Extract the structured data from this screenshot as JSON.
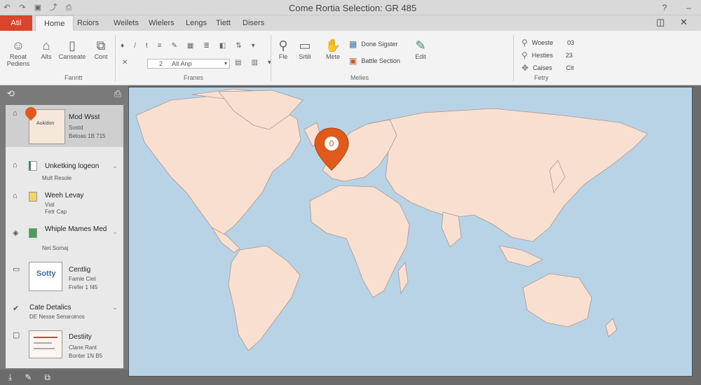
{
  "window": {
    "title": "Come Rortia Selection: GR 485",
    "qat_icons": [
      "undo-icon",
      "redo-icon",
      "save-icon",
      "share-icon",
      "print-icon"
    ],
    "right_controls": [
      "help-icon",
      "close-icon"
    ]
  },
  "tabs": {
    "file": "Atil",
    "items": [
      "Home",
      "Rciors",
      "Weilets",
      "Wielers",
      "Lengs",
      "Tiett",
      "Disers"
    ],
    "active": "Home"
  },
  "ribbon": {
    "first": [
      {
        "label": "Reoat Pediens",
        "icon": "person-icon"
      },
      {
        "label": "Alts",
        "icon": "building-icon"
      },
      {
        "label": "Canseate",
        "icon": "document-icon"
      },
      {
        "label": "Cont",
        "icon": "copy-icon"
      }
    ],
    "first_group": "Fanntt",
    "format_group": "Franes",
    "format_input": "Alt Anp",
    "format_input_prefix": "2",
    "media": [
      {
        "label": "Fle",
        "icon": "link-icon"
      },
      {
        "label": "Srtili",
        "icon": "slide-icon"
      },
      {
        "label": "Mete",
        "icon": "hand-icon"
      }
    ],
    "media_list": [
      "Done Sigster",
      "Battle Section"
    ],
    "media_edit": "Edit",
    "media_group": "Melies",
    "right_list": [
      {
        "label": "Woeste",
        "value": "03",
        "icon": "pin-icon"
      },
      {
        "label": "Hesties",
        "value": "23",
        "icon": "pin-icon"
      },
      {
        "label": "Caises",
        "value": "Cit",
        "icon": "move-icon"
      }
    ],
    "right_group": "Fetry"
  },
  "sidebar": {
    "items": [
      {
        "title": "Mod Wsst",
        "sub1": "Sostd",
        "sub2": "Betoas 1B 715",
        "thumb_text": "Aukidon"
      },
      {
        "title": "Unketking logeon",
        "sub1": "Mult Resole"
      },
      {
        "title": "Weeh Levay",
        "sub1": "Viat",
        "sub2": "Fetr Cap"
      },
      {
        "title": "Whiple Mames Med",
        "sub1": "Net Somaj"
      },
      {
        "title": "Centlig",
        "sub1": "Famie Ciet",
        "sub2": "Frefer 1 f45",
        "thumb_text": "Sotty"
      },
      {
        "title": "Cate Detalics",
        "sub1": "DE Nesse Senaroinos"
      },
      {
        "title": "Destiity",
        "sub1": "Clane Rant",
        "sub2": "Bonter 1N B5"
      }
    ]
  },
  "map": {
    "marker_label": "0",
    "marker_color": "#e05a1c",
    "land_color": "#f8dfcf",
    "ocean_color": "#b9d3e6"
  },
  "status_icons": [
    "pin-icon",
    "pen-icon",
    "copy-icon"
  ]
}
